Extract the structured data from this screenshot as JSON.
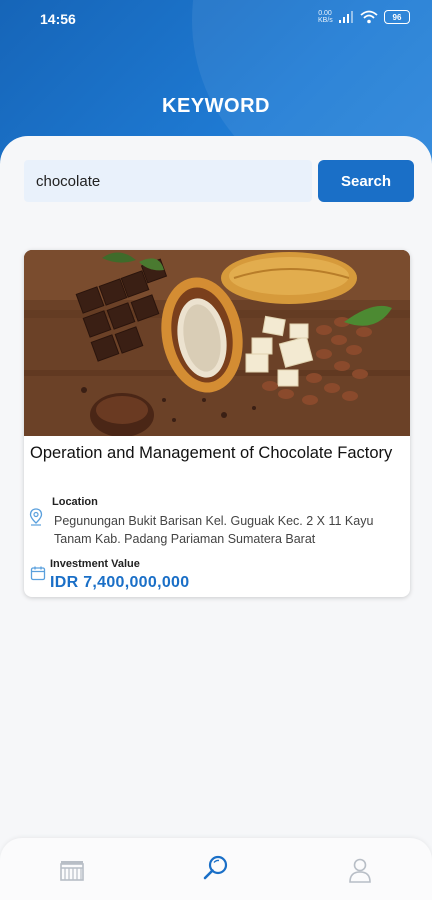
{
  "status_bar": {
    "time": "14:56",
    "net_speed": "0.00 KB/s",
    "battery": "96"
  },
  "header": {
    "title": "KEYWORD"
  },
  "search": {
    "value": "chocolate",
    "button_label": "Search"
  },
  "results": [
    {
      "title": "Operation and Management of Chocolate Factory",
      "location_label": "Location",
      "location": "Pegunungan Bukit Barisan Kel. Guguak Kec. 2 X 11 Kayu Tanam Kab. Padang Pariaman Sumatera Barat",
      "investment_label": "Investment Value",
      "investment_value": "IDR 7,400,000,000"
    }
  ],
  "bottom_nav": {
    "items": [
      "home-icon",
      "search-icon",
      "profile-icon"
    ],
    "active": "search-icon"
  },
  "colors": {
    "primary": "#1a6fc7",
    "header_bg": "#1f7bd4",
    "active_nav": "#1a6fc7",
    "inactive_nav": "#b8bec6"
  }
}
